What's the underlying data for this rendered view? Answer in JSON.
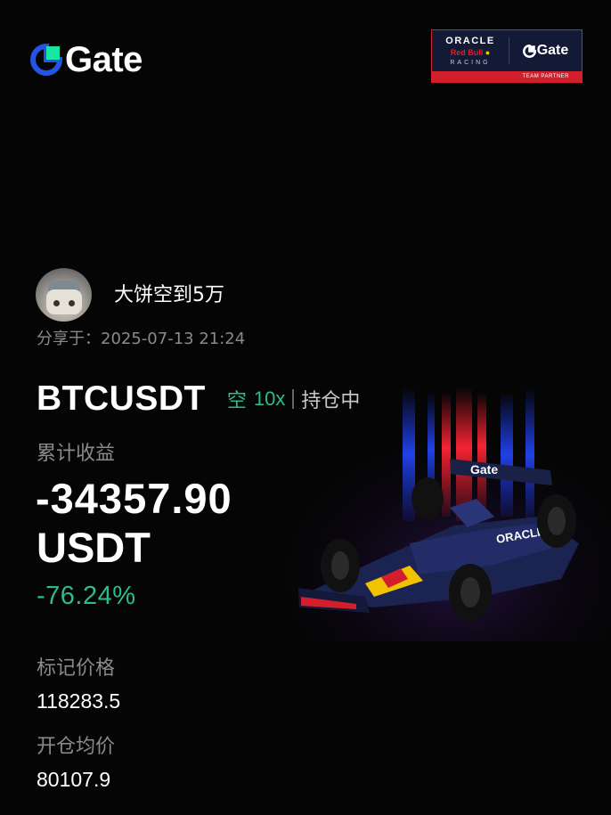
{
  "brand": {
    "name": "Gate"
  },
  "partner_badge": {
    "oracle": "ORACLE",
    "red_bull": "Red Bull",
    "racing": "RACING",
    "gate": "Gate",
    "tagline": "TEAM PARTNER"
  },
  "user": {
    "nickname": "大饼空到5万",
    "shared_at": "分享于：2025-07-13 21:24"
  },
  "position": {
    "pair": "BTCUSDT",
    "direction": "空",
    "leverage": "10x",
    "status": "持仓中",
    "pnl_label": "累计收益",
    "pnl_value": "-34357.90",
    "pnl_unit": "USDT",
    "pnl_percent": "-76.24%",
    "mark_price_label": "标记价格",
    "mark_price": "118283.5",
    "entry_price_label": "开仓均价",
    "entry_price": "80107.9"
  },
  "colors": {
    "background": "#050505",
    "profit_loss_green": "#2bbc8a",
    "muted_text": "#8a8a8a",
    "brand_blue": "#2354e6",
    "brand_green": "#17e6a1",
    "partner_red": "#d31f2b"
  },
  "icons": [
    "gate-logo-icon",
    "avatar-image",
    "f1-car-illustration"
  ]
}
